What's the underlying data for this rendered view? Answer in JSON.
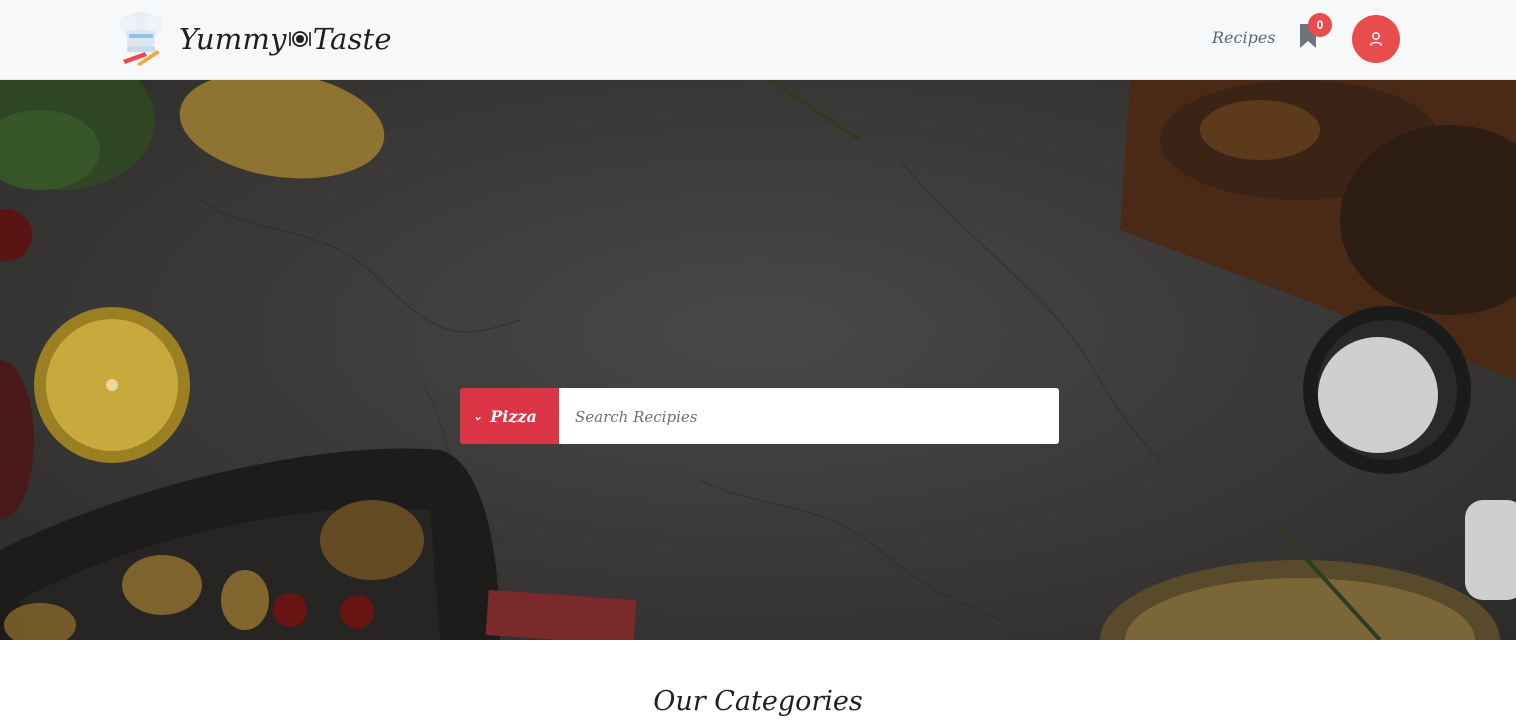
{
  "brand": {
    "name_part1": "Yummy",
    "name_part2": "Taste",
    "logo_icon": "chef-hat-icon"
  },
  "nav": {
    "recipes_label": "Recipes",
    "bookmark_count": "0"
  },
  "search": {
    "category_label": "Pizza",
    "placeholder": "Search Recipies"
  },
  "sections": {
    "categories_title": "Our Categories"
  },
  "colors": {
    "accent": "#dc3545",
    "badge": "#e84c4c",
    "navbar_bg": "#f7f8f9"
  }
}
